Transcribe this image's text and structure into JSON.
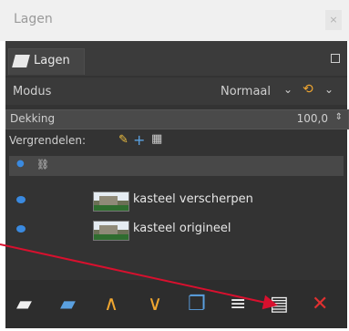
{
  "window": {
    "title": "Lagen",
    "close_glyph": "×"
  },
  "tab": {
    "label": "Lagen",
    "icon": "layers-icon",
    "menu_icon": "tab-menu-icon"
  },
  "mode": {
    "label": "Modus",
    "value": "Normaal"
  },
  "opacity": {
    "label": "Dekking",
    "value": "100,0"
  },
  "lock": {
    "label": "Vergrendelen:"
  },
  "layers": [
    {
      "name": "kasteel verscherpen",
      "visible": true
    },
    {
      "name": "kasteel origineel",
      "visible": true
    }
  ],
  "toolbar": {
    "new_layer_icon": "new-layer-icon",
    "new_group_icon": "new-layer-group-icon",
    "raise_icon": "raise-layer-icon",
    "lower_icon": "lower-layer-icon",
    "duplicate_icon": "duplicate-layer-icon",
    "merge_icon": "merge-down-icon",
    "mask_icon": "add-layer-mask-icon",
    "delete_icon": "delete-layer-icon"
  },
  "colors": {
    "panel_bg": "#333333",
    "accent_blue": "#3a8ae0",
    "accent_orange": "#f0a630",
    "delete_red": "#e03030",
    "annotation_arrow": "#d8102e"
  }
}
